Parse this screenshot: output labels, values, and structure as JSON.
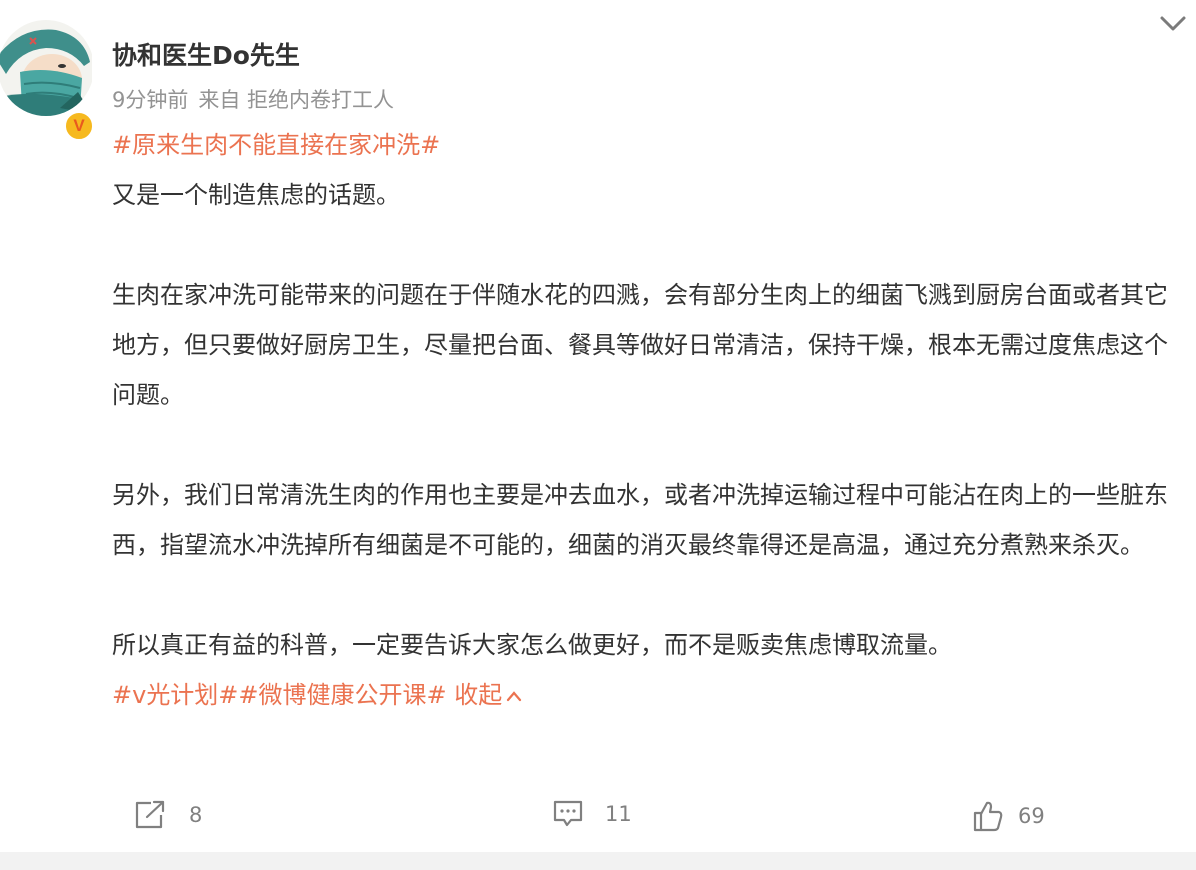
{
  "author": {
    "name": "协和医生Do先生",
    "verified_badge": "V"
  },
  "meta": {
    "time": "9分钟前",
    "source": "来自 拒绝内卷打工人"
  },
  "post": {
    "topic": "#原来生肉不能直接在家冲洗#",
    "paragraphs": [
      "又是一个制造焦虑的话题。",
      "生肉在家冲洗可能带来的问题在于伴随水花的四溅，会有部分生肉上的细菌飞溅到厨房台面或者其它地方，但只要做好厨房卫生，尽量把台面、餐具等做好日常清洁，保持干燥，根本无需过度焦虑这个问题。",
      "另外，我们日常清洗生肉的作用也主要是冲去血水，或者冲洗掉运输过程中可能沾在肉上的一些脏东西，指望流水冲洗掉所有细菌是不可能的，细菌的消灭最终靠得还是高温，通过充分煮熟来杀灭。",
      "所以真正有益的科普，一定要告诉大家怎么做更好，而不是贩卖焦虑博取流量。"
    ],
    "tags": "#v光计划##微博健康公开课#",
    "fold_label": "收起"
  },
  "actions": {
    "repost_count": "8",
    "comment_count": "11",
    "like_count": "69"
  },
  "colors": {
    "accent": "#eb7350",
    "meta": "#939393",
    "badge": "#f6b91f"
  },
  "icons": [
    "avatar-illustration",
    "verified-badge-icon",
    "chevron-down-icon",
    "repost-icon",
    "comment-icon",
    "like-icon",
    "chevron-up-icon"
  ]
}
